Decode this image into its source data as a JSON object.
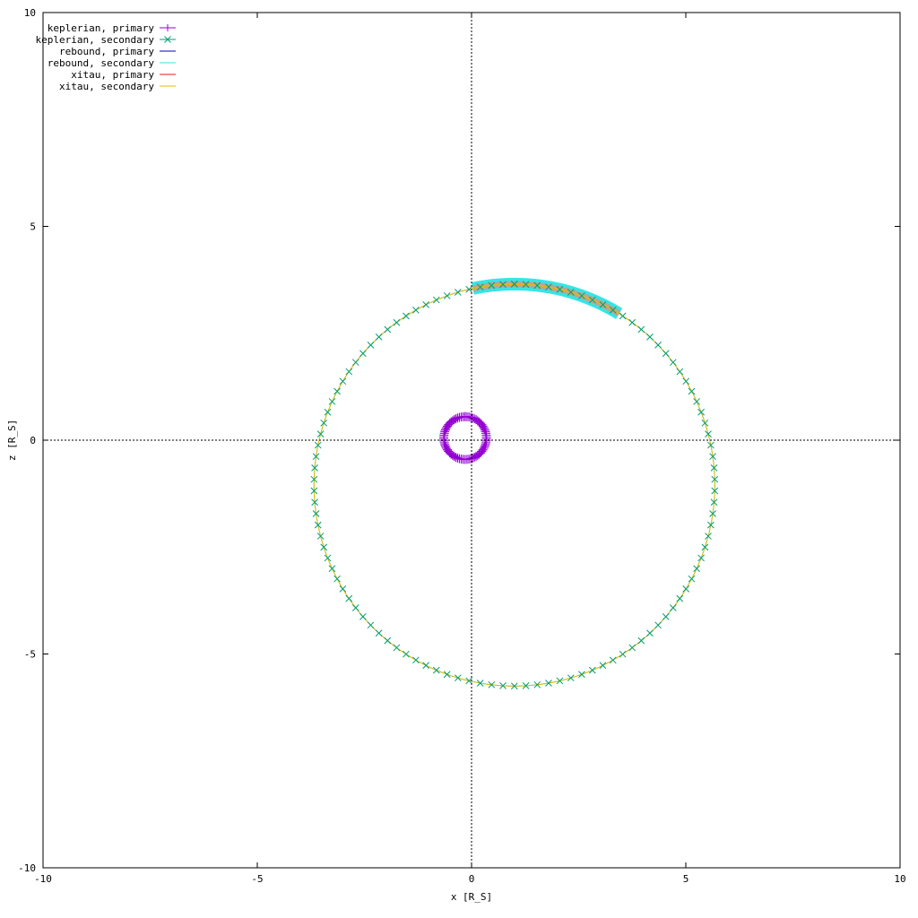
{
  "chart_data": {
    "type": "scatter",
    "title": "",
    "xlabel": "x [R_S]",
    "ylabel": "z [R_S]",
    "xlim": [
      -10,
      10
    ],
    "ylim": [
      -10,
      10
    ],
    "xticks": [
      "-10",
      "-5",
      "0",
      "5",
      "10"
    ],
    "yticks": [
      "10",
      "5",
      "0",
      "-5",
      "-10"
    ],
    "grid": false,
    "zero_axes": true,
    "legend_position": "top-left",
    "orbit_primary": {
      "a": 0.5,
      "e": 0.1,
      "center": [
        -0.15,
        0.05
      ],
      "periapsis_angle_deg": 90
    },
    "orbit_secondary": {
      "a": 4.7,
      "e": 0.1,
      "center": [
        1.0,
        -1.05
      ],
      "periapsis_angle_deg": 90
    },
    "series": [
      {
        "name": "keplerian, primary",
        "color": "#9400d3",
        "marker": "plus",
        "orbit": "primary"
      },
      {
        "name": "keplerian, secondary",
        "color": "#009e73",
        "marker": "cross",
        "orbit": "secondary"
      },
      {
        "name": "rebound, primary",
        "color": "#0000cc",
        "marker": "line",
        "orbit": "primary"
      },
      {
        "name": "rebound, secondary",
        "color": "#33e6e6",
        "marker": "line",
        "orbit": "secondary",
        "thick_arc_from": [
          -0.1,
          3.6
        ],
        "thick_arc_to": [
          3.5,
          2.95
        ]
      },
      {
        "name": "xitau, primary",
        "color": "#e51e10",
        "marker": "line",
        "orbit": "primary"
      },
      {
        "name": "xitau, secondary",
        "color": "#e6b800",
        "marker": "line",
        "orbit": "secondary"
      }
    ]
  }
}
